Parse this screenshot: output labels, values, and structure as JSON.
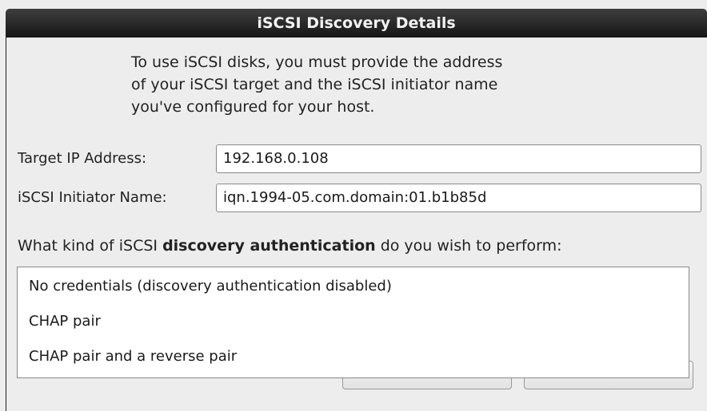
{
  "dialog": {
    "title": "iSCSI Discovery Details",
    "intro_lines": [
      "To use iSCSI disks, you must provide the address",
      "of your iSCSI target and the iSCSI initiator name",
      "you've configured for your host."
    ]
  },
  "form": {
    "target_ip": {
      "label": "Target IP Address:",
      "value": "192.168.0.108"
    },
    "initiator_name": {
      "label": "iSCSI Initiator Name:",
      "value": "iqn.1994-05.com.domain:01.b1b85d"
    }
  },
  "auth": {
    "question_prefix": "What kind of iSCSI ",
    "question_bold": "discovery authentication",
    "question_suffix": " do you wish to perform:",
    "options": [
      "No credentials (discovery authentication disabled)",
      "CHAP pair",
      "CHAP pair and a reverse pair"
    ]
  },
  "colors": {
    "titlebar": "#161616",
    "background": "#ededed",
    "field_background": "#ffffff"
  }
}
